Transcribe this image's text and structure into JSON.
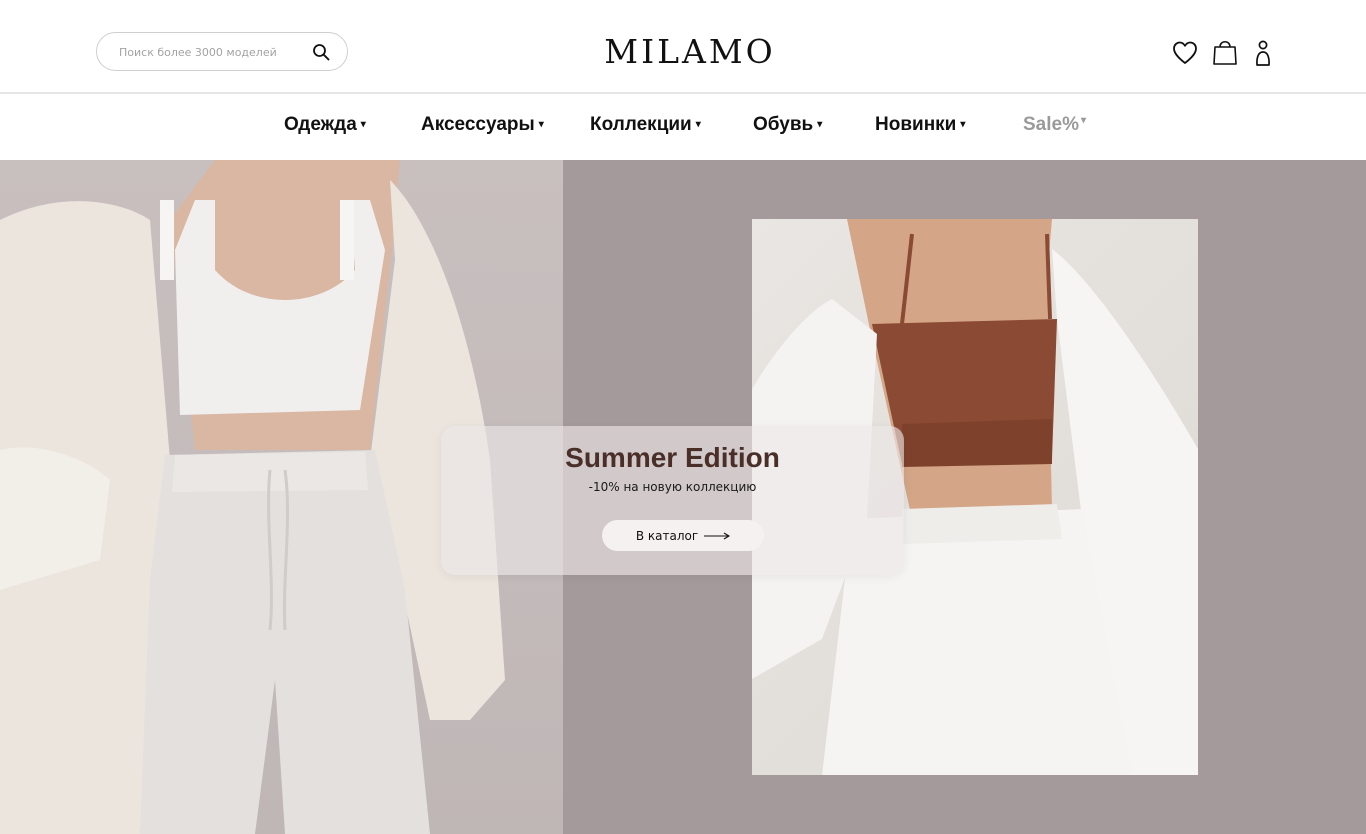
{
  "header": {
    "logo": "MILAMO",
    "search": {
      "placeholder": "Поиск более 3000 моделей",
      "icon": "search-icon"
    },
    "icons": [
      "heart-icon",
      "shopping-bag-icon",
      "user-icon"
    ]
  },
  "nav": {
    "items": [
      {
        "label": "Одежда",
        "caret": "▾"
      },
      {
        "label": "Аксессуары",
        "caret": "▾"
      },
      {
        "label": "Коллекции",
        "caret": "▾"
      },
      {
        "label": "Обувь",
        "caret": "▾"
      },
      {
        "label": "Новинки",
        "caret": "▾"
      },
      {
        "label": "Sale%",
        "caret": "▾"
      }
    ]
  },
  "promo": {
    "title": "Summer Edition",
    "subtitle": "-10% на новую коллекцию",
    "button_label": "В каталог"
  },
  "colors": {
    "hero_left_bg": "#c4bbbb",
    "hero_right_bg": "#a59a9b",
    "promo_title": "#4a2f28",
    "sale": "#9a9a9a"
  }
}
